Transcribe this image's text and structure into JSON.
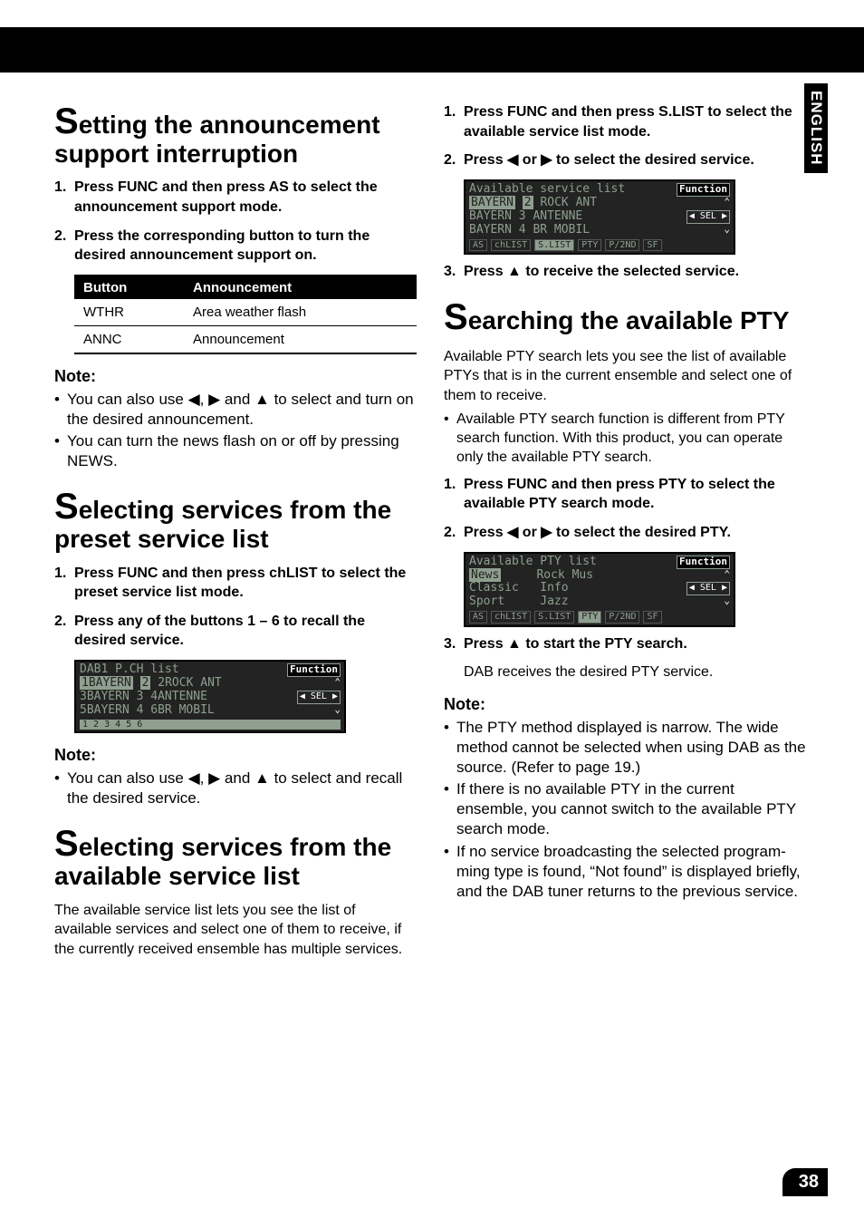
{
  "side_tab": "ENGLISH",
  "page_number": "38",
  "arrows": {
    "left": "◀",
    "right": "▶",
    "up": "▲"
  },
  "left": {
    "sec1": {
      "title_pre": "S",
      "title_rest": "etting the announcement sup­port interruption",
      "s1_num": "1.",
      "s1": "Press FUNC and then press AS to select the announcement support mode.",
      "s2_num": "2.",
      "s2": "Press the corresponding button to turn the desired announcement support on.",
      "th1": "Button",
      "th2": "Announcement",
      "r1c1": "WTHR",
      "r1c2": "Area weather flash",
      "r2c1": "ANNC",
      "r2c2": "Announcement",
      "note": "Note:",
      "n1a": "You can also use ",
      "n1b": ", ",
      "n1c": " and ",
      "n1d": " to select and turn on the desired announcement.",
      "n2": "You can turn the news flash on or off by pressing NEWS."
    },
    "sec2": {
      "title_pre": "S",
      "title_rest": "electing services from the pre­set service list",
      "s1_num": "1.",
      "s1": "Press FUNC and then press chLIST to select the preset service list mode.",
      "s2_num": "2.",
      "s2": "Press any of the buttons 1 – 6 to recall the desired service.",
      "note": "Note:",
      "n1a": "You can also use ",
      "n1b": ", ",
      "n1c": " and ",
      "n1d": " to select and recall the desired service."
    },
    "sec3": {
      "title_pre": "S",
      "title_rest": "electing services from the avail­able service list",
      "p": "The available service list lets you see the list of available services and select one of them to receive, if the currently received ensemble has multiple services."
    },
    "lcd1": {
      "title": "DAB1 P.CH list",
      "fn": "Function",
      "rows": [
        [
          "1BAYERN",
          "2",
          "2ROCK ANT"
        ],
        [
          "3BAYERN",
          "3",
          "4ANTENNE"
        ],
        [
          "5BAYERN",
          "4",
          "6BR MOBIL"
        ]
      ],
      "nums": "1   2      3   4      5   6",
      "sel": "SEL"
    }
  },
  "right": {
    "s1_num": "1.",
    "s1": "Press FUNC and then press S.LIST to select the available service list mode.",
    "s2_num": "2.",
    "s2a": "Press ",
    "s2b": " or ",
    "s2c": " to select the desired ser­vice.",
    "s3_num": "3.",
    "s3a": "Press ",
    "s3b": " to receive the selected service.",
    "sec2": {
      "title_pre": "S",
      "title_rest": "earching the available PTY",
      "p1": "Available PTY search lets you see the list of available PTYs that is in the current ensemble and select one of them to receive.",
      "b1": "Available PTY search function is different from PTY search function. With this product, you can operate only the available PTY search.",
      "s1_num": "1.",
      "s1": "Press FUNC and then press PTY to select the available PTY search mode.",
      "s2_num": "2.",
      "s2a": "Press ",
      "s2b": " or ",
      "s2c": " to select the desired PTY.",
      "s3_num": "3.",
      "s3a": "Press ",
      "s3b": " to start the PTY search.",
      "sub3": "DAB receives the desired PTY service.",
      "note": "Note:",
      "n1": "The PTY method displayed is narrow. The wide method cannot be selected when using DAB as the source. (Refer to page 19.)",
      "n2": "If there is no available PTY in the current ensemble, you cannot switch to the available PTY search mode.",
      "n3": "If no service broadcasting the selected program­ming type is found, “Not found” is displayed briefly, and the DAB tuner returns to the previous service."
    },
    "lcd2": {
      "title": "Available service list",
      "fn": "Function",
      "rows": [
        [
          "BAYERN",
          "2",
          "ROCK ANT"
        ],
        [
          "BAYERN",
          "3",
          "ANTENNE"
        ],
        [
          "BAYERN",
          "4",
          "BR MOBIL"
        ]
      ],
      "strip": [
        "AS",
        "chLIST",
        "S.LIST",
        "PTY",
        "P/2ND",
        "SF"
      ],
      "on": 2,
      "sel": "SEL"
    },
    "lcd3": {
      "title": "Available PTY list",
      "fn": "Function",
      "rows": [
        [
          "News",
          "Rock Mus"
        ],
        [
          "Classic",
          "Info"
        ],
        [
          "Sport",
          "Jazz"
        ]
      ],
      "strip": [
        "AS",
        "chLIST",
        "S.LIST",
        "PTY",
        "P/2ND",
        "SF"
      ],
      "on": 3,
      "sel": "SEL"
    }
  }
}
